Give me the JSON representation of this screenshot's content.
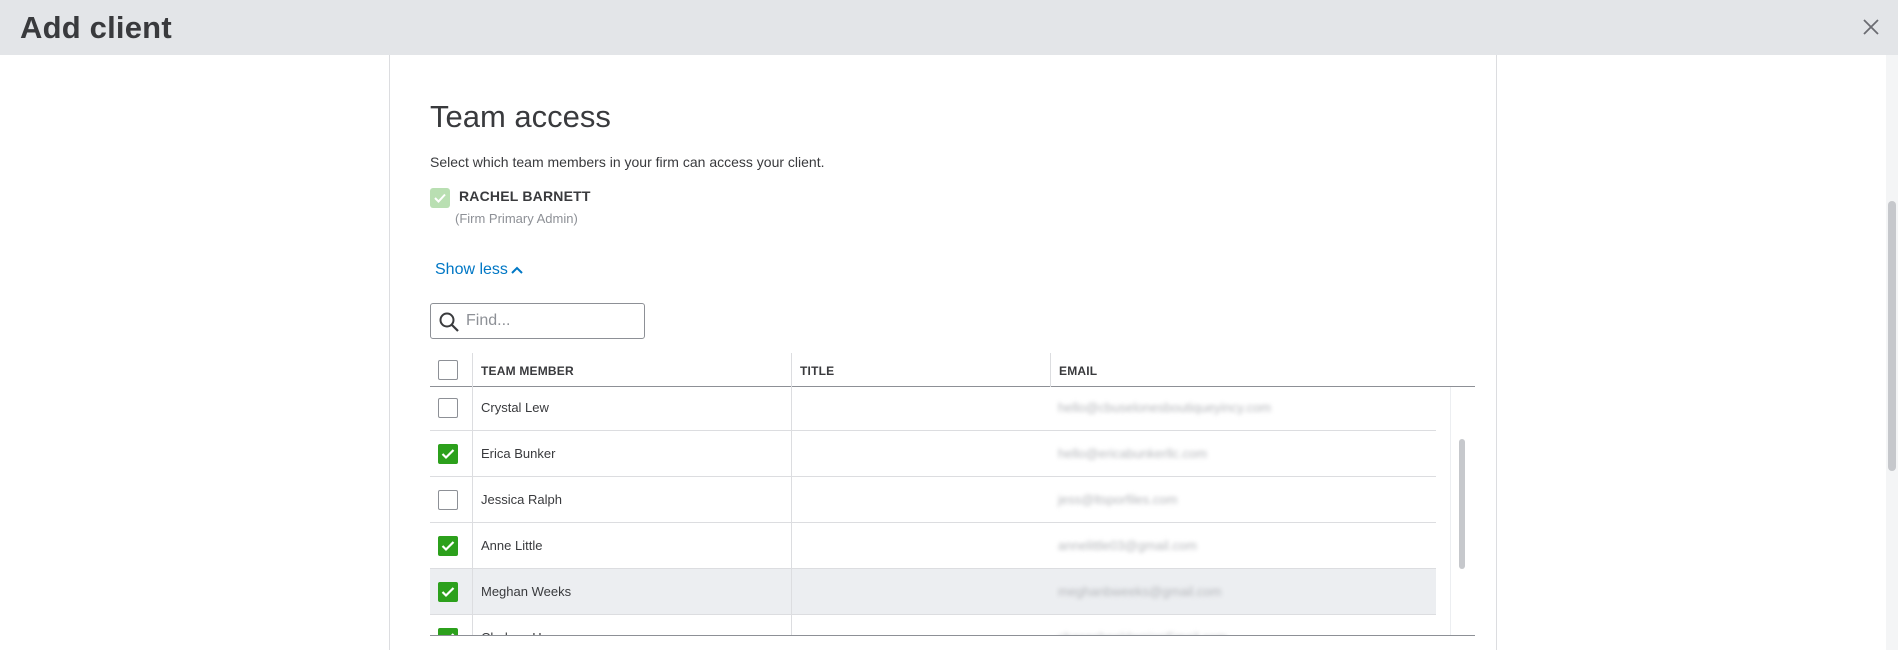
{
  "header": {
    "title": "Add client",
    "close_label": "close"
  },
  "section": {
    "title": "Team access",
    "subtitle": "Select which team members in your firm can access your client."
  },
  "admin": {
    "name": "RACHEL BARNETT",
    "role": "(Firm Primary Admin)",
    "checked": true
  },
  "show_less": {
    "label": "Show less"
  },
  "search": {
    "placeholder": "Find..."
  },
  "table": {
    "columns": {
      "member": "TEAM MEMBER",
      "title": "TITLE",
      "email": "EMAIL"
    },
    "rows": [
      {
        "name": "Crystal Lew",
        "title": "",
        "email": "hello@cbuselonesboutiqueyincy.com",
        "checked": false
      },
      {
        "name": "Erica Bunker",
        "title": "",
        "email": "hello@ericabunkerllc.com",
        "checked": true
      },
      {
        "name": "Jessica Ralph",
        "title": "",
        "email": "jess@ltsporfiles.com",
        "checked": false
      },
      {
        "name": "Anne Little",
        "title": "",
        "email": "annelittle03@gmail.com",
        "checked": true
      },
      {
        "name": "Meghan Weeks",
        "title": "",
        "email": "meghanbweeks@gmail.com",
        "checked": true
      },
      {
        "name": "Chelsea Hansen",
        "title": "",
        "email": "chasesheeldersionEmail.com",
        "checked": true
      }
    ]
  },
  "colors": {
    "accent_green": "#2ca01c",
    "link_blue": "#0077c5",
    "header_bg": "#e3e5e8"
  }
}
